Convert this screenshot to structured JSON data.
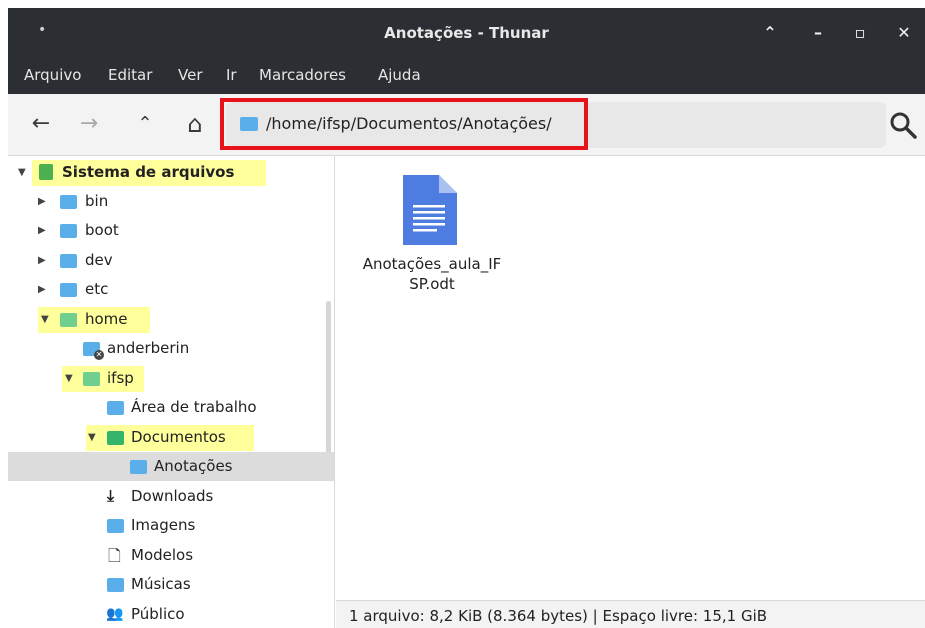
{
  "window": {
    "title": "Anotações - Thunar",
    "menu_glyph": "•",
    "buttons": {
      "shade": "⌃",
      "minimize": "–",
      "maximize": "▫",
      "close": "✕"
    }
  },
  "menubar": {
    "items": [
      "Arquivo",
      "Editar",
      "Ver",
      "Ir",
      "Marcadores",
      "Ajuda"
    ]
  },
  "toolbar": {
    "back": "←",
    "forward": "→",
    "up": "⌃",
    "home": "⌂",
    "location": "/home/ifsp/Documentos/Anotações/",
    "highlight_color": "#e8131a"
  },
  "sidebar": {
    "highlight_color": "#ffff9c",
    "items": [
      {
        "label": "Sistema de arquivos",
        "icon": "drive-icon",
        "expander": "▼"
      },
      {
        "label": "bin",
        "icon": "folder-link-icon",
        "expander": "▶"
      },
      {
        "label": "boot",
        "icon": "folder-icon",
        "expander": "▶"
      },
      {
        "label": "dev",
        "icon": "folder-icon",
        "expander": "▶"
      },
      {
        "label": "etc",
        "icon": "folder-icon",
        "expander": "▶"
      },
      {
        "label": "home",
        "icon": "folder-icon",
        "expander": "▼"
      },
      {
        "label": "anderberin",
        "icon": "folder-locked-icon",
        "expander": ""
      },
      {
        "label": "ifsp",
        "icon": "home-folder-icon",
        "expander": "▼"
      },
      {
        "label": "Área de trabalho",
        "icon": "desktop-folder-icon",
        "expander": ""
      },
      {
        "label": "Documentos",
        "icon": "documents-folder-icon",
        "expander": "▼"
      },
      {
        "label": "Anotações",
        "icon": "folder-icon",
        "expander": ""
      },
      {
        "label": "Downloads",
        "icon": "download-icon",
        "glyph": "⤓",
        "expander": ""
      },
      {
        "label": "Imagens",
        "icon": "pictures-folder-icon",
        "expander": ""
      },
      {
        "label": "Modelos",
        "icon": "template-icon",
        "glyph": "🗋",
        "expander": ""
      },
      {
        "label": "Músicas",
        "icon": "music-folder-icon",
        "expander": ""
      },
      {
        "label": "Público",
        "icon": "users-icon",
        "glyph": "👥",
        "expander": ""
      }
    ]
  },
  "content": {
    "files": [
      {
        "name_line1": "Anotações_aula_IF",
        "name_line2": "SP.odt",
        "icon": "document-icon",
        "icon_color": "#4f7ce0"
      }
    ]
  },
  "statusbar": {
    "text": "1 arquivo: 8,2 KiB (8.364 bytes)  |  Espaço livre: 15,1 GiB"
  }
}
